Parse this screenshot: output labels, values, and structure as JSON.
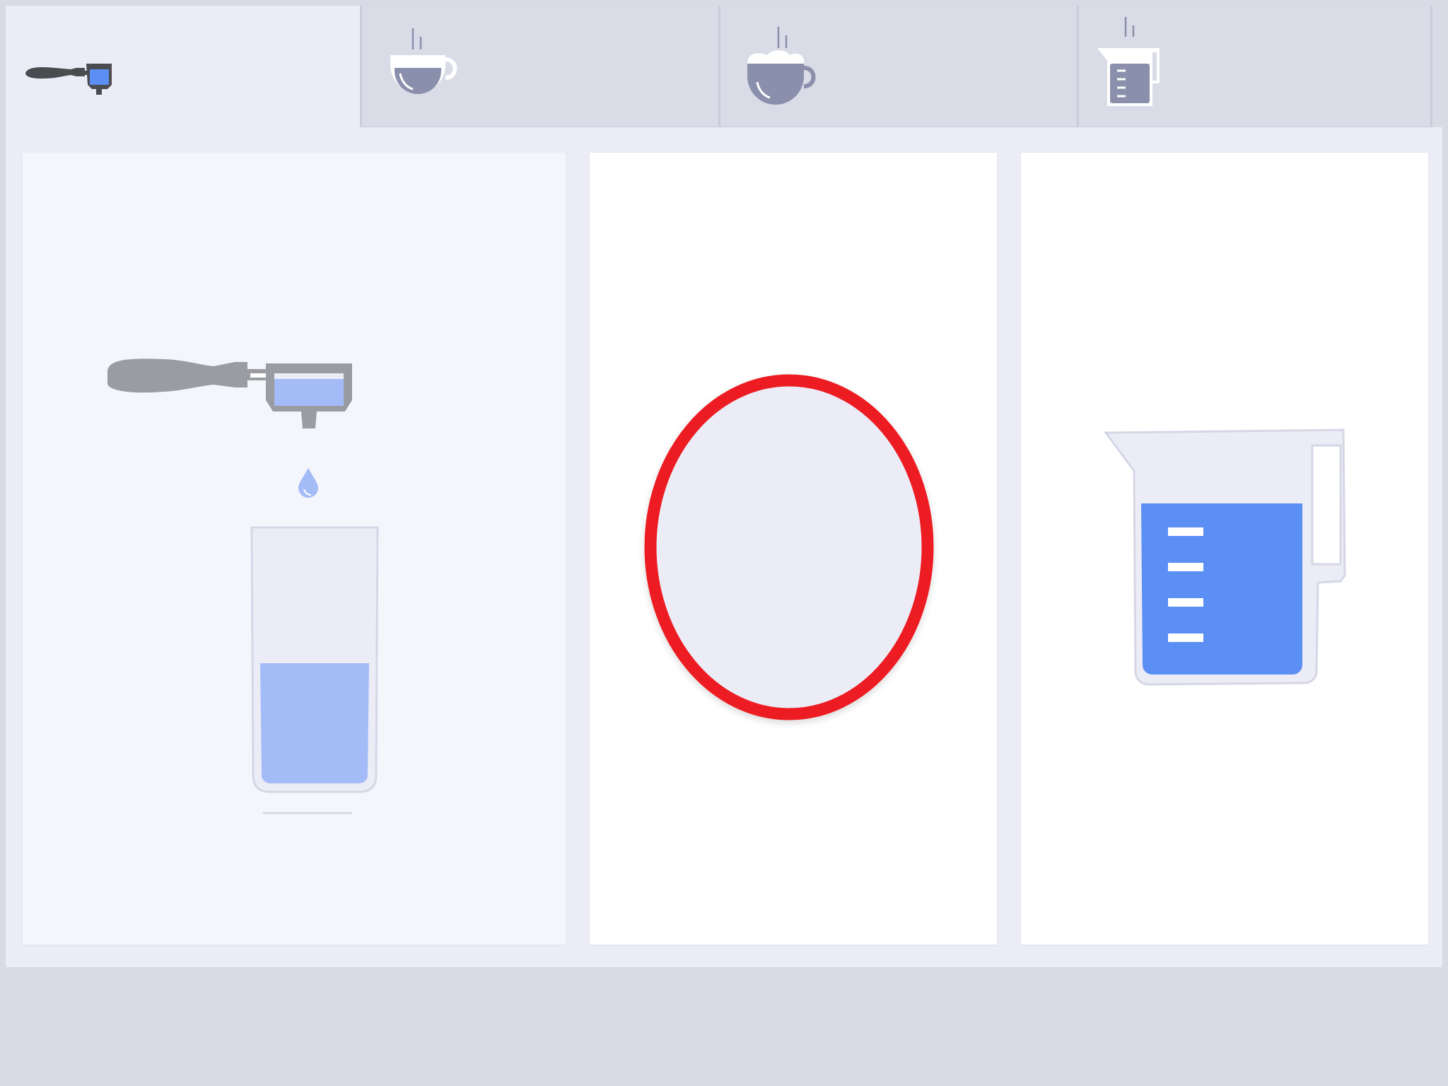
{
  "tabs": [
    {
      "id": "espresso",
      "icon": "portafilter-icon",
      "selected": true
    },
    {
      "id": "coffee",
      "icon": "coffee-cup-icon",
      "selected": false
    },
    {
      "id": "cappuccino",
      "icon": "foam-cup-icon",
      "selected": false
    },
    {
      "id": "hot-water",
      "icon": "water-jug-icon",
      "selected": false
    }
  ],
  "options": [
    {
      "id": "glass",
      "icon": "portafilter-glass-icon",
      "selected": true,
      "glass_fill": 0.48
    },
    {
      "id": "cup",
      "icon": "empty-cup-icon",
      "highlighted": true
    },
    {
      "id": "jug",
      "icon": "measuring-jug-icon",
      "selected": false,
      "jug_fill": 0.72
    }
  ],
  "colors": {
    "accent_blue": "#5b8ff4",
    "light_blue": "#a3bbf7",
    "highlight_red": "#ec1c24",
    "icon_slate": "#8a90ac",
    "handle_gray": "#9a9ca2",
    "dark_handle": "#4b4c50"
  }
}
